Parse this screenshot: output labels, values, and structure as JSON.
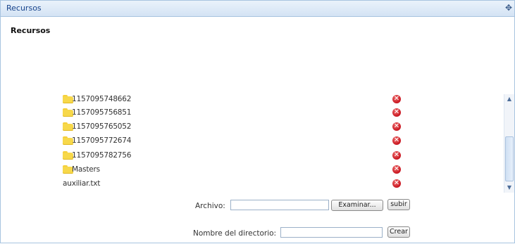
{
  "panel": {
    "title": "Recursos",
    "tool_icon": "✥"
  },
  "section": {
    "title": "Recursos"
  },
  "items": [
    {
      "name": "1157095748662",
      "type": "folder"
    },
    {
      "name": "1157095756851",
      "type": "folder"
    },
    {
      "name": "1157095765052",
      "type": "folder"
    },
    {
      "name": "1157095772674",
      "type": "folder"
    },
    {
      "name": "1157095782756",
      "type": "folder"
    },
    {
      "name": "Masters",
      "type": "folder"
    },
    {
      "name": "auxiliar.txt",
      "type": "file"
    }
  ],
  "icons": {
    "delete": "delete-icon",
    "folder": "folder-icon"
  },
  "delete_glyph": "✕",
  "scroll": {
    "up": "▲",
    "down": "▼"
  },
  "upload": {
    "label": "Archivo:",
    "value": "",
    "browse_label": "Examinar...",
    "submit_label": "subir"
  },
  "directory": {
    "label": "Nombre del directorio:",
    "value": "",
    "create_label": "Crear"
  }
}
